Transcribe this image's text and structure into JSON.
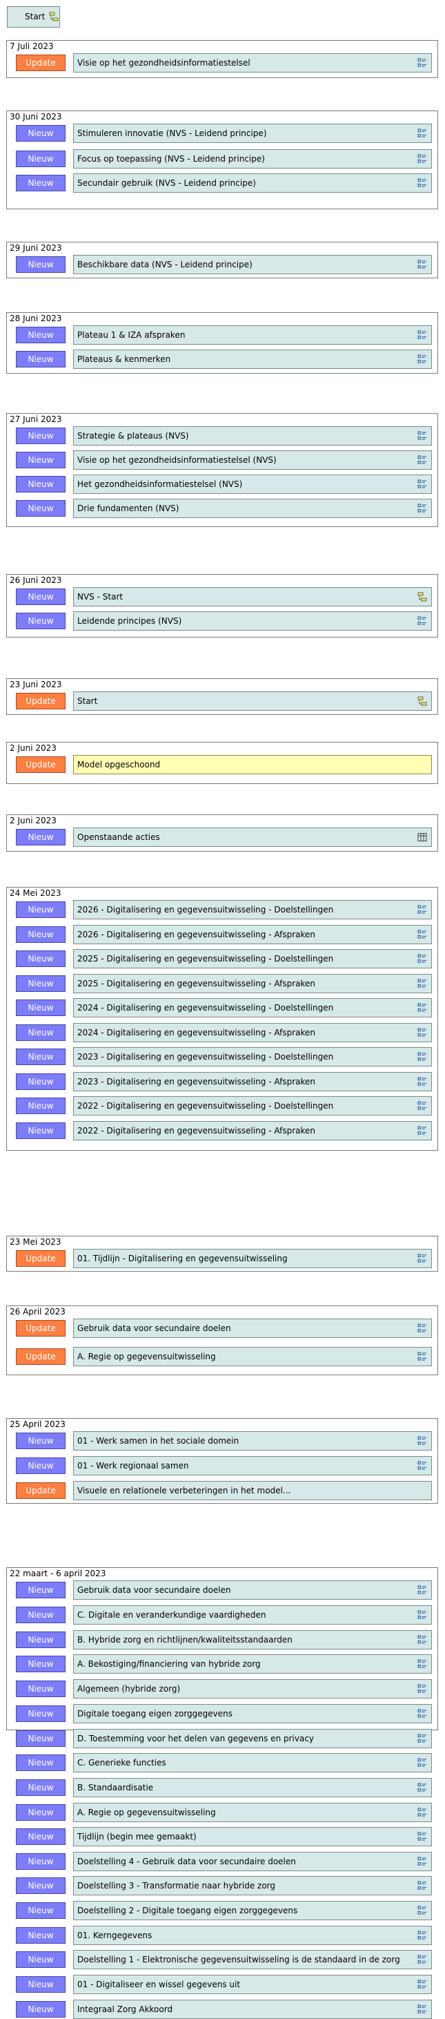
{
  "start": {
    "label": "Start",
    "icon": "diagram-icon"
  },
  "labels": {
    "new": "Nieuw",
    "update": "Update"
  },
  "colors": {
    "new": "#7d7dfa",
    "update": "#ff7f42",
    "element": "#d6e8e8",
    "note": "#ffffb4"
  },
  "groups": [
    {
      "date": "7 Juli 2023",
      "items": [
        {
          "type": "update",
          "label": "Visie op het gezondheidsinformatiestelsel",
          "icon": "view-icon"
        }
      ]
    },
    {
      "date": "30 Juni  2023",
      "items": [
        {
          "type": "new",
          "label": "Stimuleren innovatie (NVS - Leidend principe)",
          "icon": "view-icon"
        },
        {
          "type": "new",
          "label": "Focus op toepassing (NVS - Leidend principe)",
          "icon": "view-icon"
        },
        {
          "type": "new",
          "label": "Secundair gebruik (NVS - Leidend principe)",
          "icon": "view-icon"
        }
      ]
    },
    {
      "date": "29 Juni  2023",
      "items": [
        {
          "type": "new",
          "label": "Beschikbare data (NVS - Leidend principe)",
          "icon": "view-icon"
        }
      ]
    },
    {
      "date": "28 Juni  2023",
      "items": [
        {
          "type": "new",
          "label": "Plateau 1 & IZA afspraken",
          "icon": "view-icon"
        },
        {
          "type": "new",
          "label": "Plateaus & kenmerken",
          "icon": "view-icon"
        }
      ]
    },
    {
      "date": "27 Juni  2023",
      "items": [
        {
          "type": "new",
          "label": "Strategie & plateaus (NVS)",
          "icon": "view-icon"
        },
        {
          "type": "new",
          "label": "Visie op het gezondheidsinformatiestelsel (NVS)",
          "icon": "view-icon"
        },
        {
          "type": "new",
          "label": "Het gezondheidsinformatiestelsel (NVS)",
          "icon": "view-icon"
        },
        {
          "type": "new",
          "label": "Drie fundamenten (NVS)",
          "icon": "view-icon"
        }
      ]
    },
    {
      "date": "26 Juni  2023",
      "items": [
        {
          "type": "new",
          "label": "NVS - Start",
          "icon": "diagram-icon"
        },
        {
          "type": "new",
          "label": "Leidende principes (NVS)",
          "icon": "view-icon"
        }
      ]
    },
    {
      "date": "23 Juni  2023",
      "items": [
        {
          "type": "update",
          "label": "Start",
          "icon": "diagram-icon"
        }
      ]
    },
    {
      "date": "2 Juni  2023",
      "items": [
        {
          "type": "update",
          "label": "Model opgeschoond",
          "icon": "",
          "note": true
        }
      ]
    },
    {
      "date": "2 Juni  2023",
      "items": [
        {
          "type": "new",
          "label": "Openstaande acties",
          "icon": "table-icon"
        }
      ]
    },
    {
      "date": "24 Mei 2023",
      "items": [
        {
          "type": "new",
          "label": "2026 - Digitalisering en gegevensuitwisseling - Doelstellingen",
          "icon": "view-icon"
        },
        {
          "type": "new",
          "label": "2026 - Digitalisering en gegevensuitwisseling - Afspraken",
          "icon": "view-icon"
        },
        {
          "type": "new",
          "label": "2025 - Digitalisering en gegevensuitwisseling - Doelstellingen",
          "icon": "view-icon"
        },
        {
          "type": "new",
          "label": "2025 - Digitalisering en gegevensuitwisseling - Afspraken",
          "icon": "view-icon"
        },
        {
          "type": "new",
          "label": "2024 - Digitalisering en gegevensuitwisseling - Doelstellingen",
          "icon": "view-icon"
        },
        {
          "type": "new",
          "label": "2024 - Digitalisering en gegevensuitwisseling - Afspraken",
          "icon": "view-icon"
        },
        {
          "type": "new",
          "label": "2023 - Digitalisering en gegevensuitwisseling - Doelstellingen",
          "icon": "view-icon"
        },
        {
          "type": "new",
          "label": "2023 - Digitalisering en gegevensuitwisseling - Afspraken",
          "icon": "view-icon"
        },
        {
          "type": "new",
          "label": "2022 - Digitalisering en gegevensuitwisseling - Doelstellingen",
          "icon": "view-icon"
        },
        {
          "type": "new",
          "label": "2022 - Digitalisering en gegevensuitwisseling - Afspraken",
          "icon": "view-icon"
        }
      ]
    },
    {
      "date": "23 Mei 2023",
      "items": [
        {
          "type": "update",
          "label": "01. Tijdlijn - Digitalisering en gegevensuitwisseling",
          "icon": "view-icon"
        }
      ]
    },
    {
      "date": "26 April 2023",
      "items": [
        {
          "type": "update",
          "label": "Gebruik data voor secundaire doelen",
          "icon": "view-icon"
        },
        {
          "type": "update",
          "label": "A. Regie op gegevensuitwisseling",
          "icon": "view-icon"
        }
      ]
    },
    {
      "date": "25 April 2023",
      "items": [
        {
          "type": "new",
          "label": "01 - Werk samen in het sociale domein",
          "icon": "view-icon"
        },
        {
          "type": "new",
          "label": "01 - Werk regionaal samen",
          "icon": "view-icon"
        },
        {
          "type": "update",
          "label": "Visuele en relationele verbeteringen in het model...",
          "icon": ""
        }
      ]
    },
    {
      "date": "22 maart - 6 april 2023",
      "items": [
        {
          "type": "new",
          "label": "Gebruik data voor secundaire doelen",
          "icon": "view-icon"
        },
        {
          "type": "new",
          "label": "C. Digitale en veranderkundige vaardigheden",
          "icon": "view-icon"
        },
        {
          "type": "new",
          "label": "B. Hybride zorg en richtlijnen/kwaliteitsstandaarden",
          "icon": "view-icon"
        },
        {
          "type": "new",
          "label": "A. Bekostiging/financiering van hybride zorg",
          "icon": "view-icon"
        },
        {
          "type": "new",
          "label": "Algemeen (hybride zorg)",
          "icon": "view-icon"
        },
        {
          "type": "new",
          "label": "Digitale toegang eigen zorggegevens",
          "icon": "view-icon"
        },
        {
          "type": "new",
          "label": "D. Toestemming voor het delen van gegevens en privacy",
          "icon": "view-icon"
        },
        {
          "type": "new",
          "label": "C. Generieke functies",
          "icon": "view-icon"
        },
        {
          "type": "new",
          "label": "B. Standaardisatie",
          "icon": "view-icon"
        },
        {
          "type": "new",
          "label": "A. Regie op gegevensuitwisseling",
          "icon": "view-icon"
        },
        {
          "type": "new",
          "label": "Tijdlijn (begin mee gemaakt)",
          "icon": "view-icon"
        },
        {
          "type": "new",
          "label": "Doelstelling 4 - Gebruik data voor secundaire doelen",
          "icon": "view-icon"
        },
        {
          "type": "new",
          "label": "Doelstelling 3 - Transformatie naar hybride zorg",
          "icon": "view-icon"
        },
        {
          "type": "new",
          "label": "Doelstelling 2 - Digitale toegang eigen zorggegevens",
          "icon": "view-icon"
        },
        {
          "type": "new",
          "label": "01. Kerngegevens",
          "icon": "view-icon"
        },
        {
          "type": "new",
          "label": "Doelstelling 1 - Elektronische gegevensuitwisseling is de standaard in de zorg",
          "icon": "view-icon"
        },
        {
          "type": "new",
          "label": "01 - Digitaliseer en wissel gegevens uit",
          "icon": "view-icon"
        },
        {
          "type": "new",
          "label": "Integraal Zorg Akkoord",
          "icon": "view-icon"
        }
      ]
    }
  ]
}
